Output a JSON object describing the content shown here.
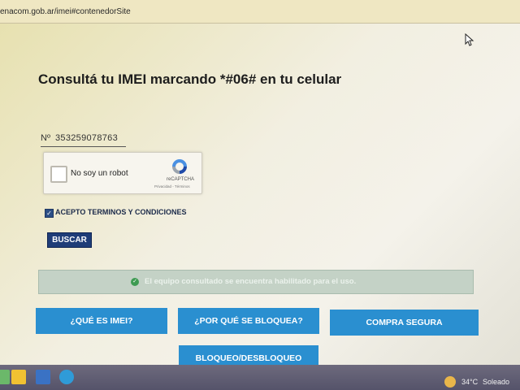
{
  "browser": {
    "url": "enacom.gob.ar/imei#contenedorSite"
  },
  "main": {
    "title": "Consultá tu IMEI marcando *#06# en tu celular",
    "imei_prefix": "Nº",
    "imei_value": "353259078763",
    "recaptcha": {
      "label": "No soy un robot",
      "brand": "reCAPTCHA",
      "links": "Privacidad - Términos"
    },
    "terms_label": "ACEPTO TERMINOS Y CONDICIONES",
    "terms_checked": true,
    "search_button": "BUSCAR",
    "alert_text": "El equipo consultado se encuentra habilitado para el uso.",
    "alert_color": "#3e9b52"
  },
  "nav_buttons": {
    "que_es": "¿QUÉ ES IMEI?",
    "por_que": "¿POR QUÉ SE BLOQUEA?",
    "compra": "COMPRA SEGURA",
    "bloqueo": "BLOQUEO/DESBLOQUEO",
    "color": "#2a8fd0"
  },
  "taskbar": {
    "icons": [
      "start-tile-icon",
      "file-explorer-icon",
      "app-icon",
      "browser-icon"
    ],
    "weather_icon": "sun-icon",
    "temperature": "34°C",
    "condition": "Soleado"
  }
}
